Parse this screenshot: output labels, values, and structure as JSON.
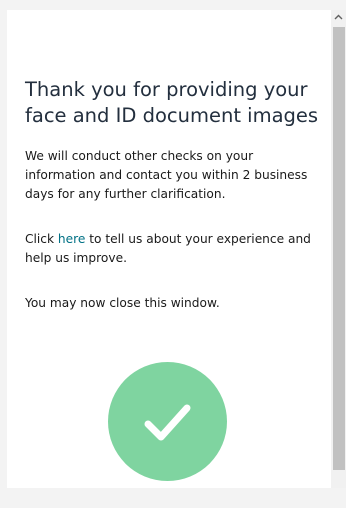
{
  "dialog": {
    "title": "Thank you for providing your face and ID document images",
    "paragraph_1": "We will conduct other checks on your information and contact you within 2 business days for any further clarification.",
    "feedback": {
      "prefix": "Click ",
      "link_text": "here",
      "suffix": " to tell us about your experience and help us improve."
    },
    "close_note": "You may now close this window."
  },
  "icons": {
    "success": "check-circle-icon",
    "scroll_up": "chevron-up-icon"
  },
  "colors": {
    "title": "#232f3e",
    "link": "#007185",
    "success": "#7fd4a0",
    "scroll_thumb": "#c1c1c1"
  }
}
